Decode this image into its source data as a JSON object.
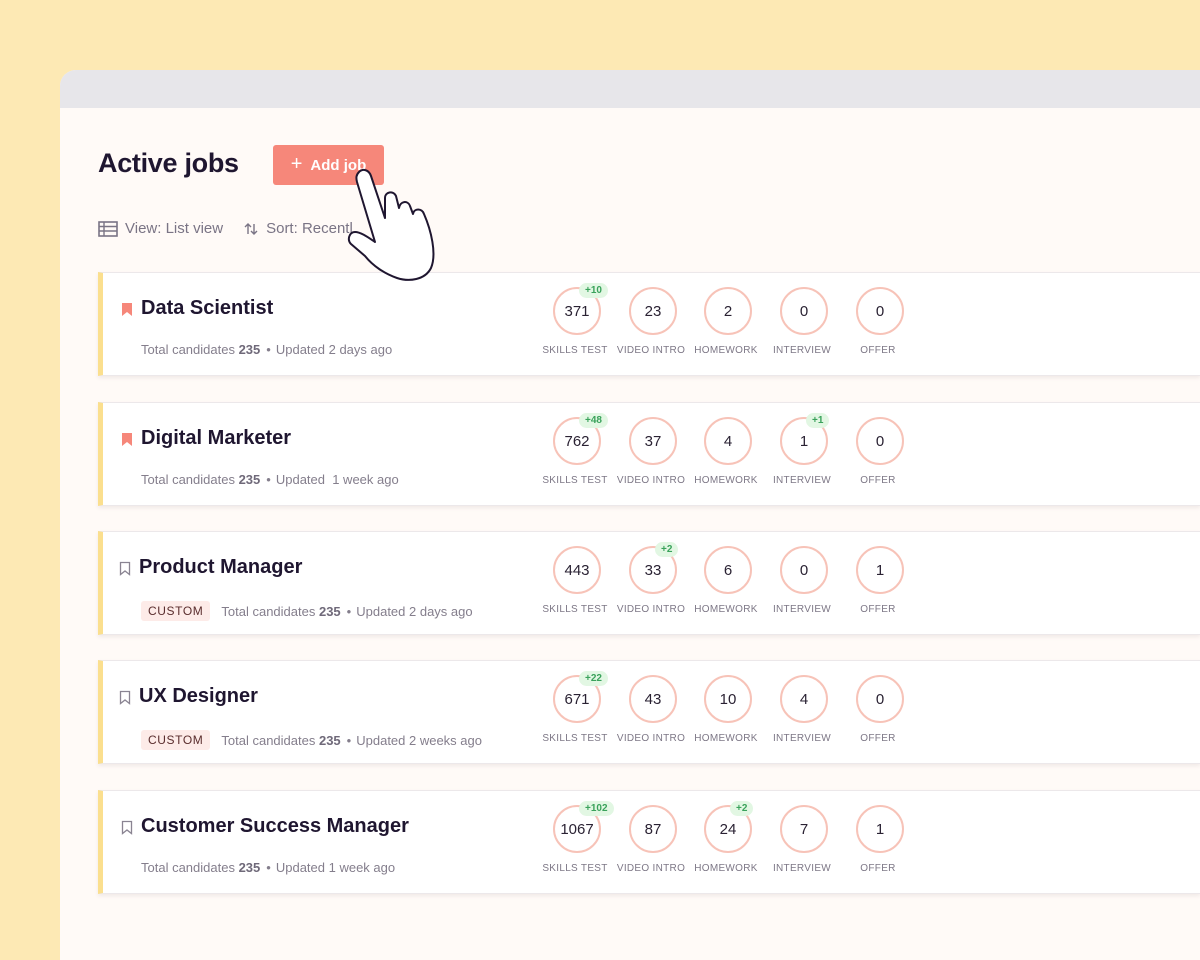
{
  "header": {
    "title": "Active jobs",
    "add_job_label": "Add job",
    "add_job_icon": "plus-icon"
  },
  "toolbar": {
    "view_label": "View: List view",
    "view_icon": "list-view-icon",
    "sort_label": "Sort: Recentl",
    "sort_icon": "sort-icon"
  },
  "colors": {
    "accent": "#f6877a",
    "background": "#fde9b4",
    "card_border": "#fbdf8e",
    "circle_border": "#f7c3b8",
    "delta_bg": "#e2f7e3",
    "delta_text": "#3aa25b"
  },
  "jobs": [
    {
      "title": "Data Scientist",
      "bookmarked": true,
      "custom": false,
      "total_label": "Total candidates",
      "total": "235",
      "updated": "Updated 2 days ago",
      "stages": [
        {
          "label": "SKILLS TEST",
          "count": "371",
          "delta": "+10"
        },
        {
          "label": "VIDEO INTRO",
          "count": "23",
          "delta": ""
        },
        {
          "label": "HOMEWORK",
          "count": "2",
          "delta": ""
        },
        {
          "label": "INTERVIEW",
          "count": "0",
          "delta": ""
        },
        {
          "label": "OFFER",
          "count": "0",
          "delta": ""
        }
      ]
    },
    {
      "title": "Digital Marketer",
      "bookmarked": true,
      "custom": false,
      "total_label": "Total candidates",
      "total": "235",
      "updated": "Updated  1 week ago",
      "stages": [
        {
          "label": "SKILLS TEST",
          "count": "762",
          "delta": "+48"
        },
        {
          "label": "VIDEO INTRO",
          "count": "37",
          "delta": ""
        },
        {
          "label": "HOMEWORK",
          "count": "4",
          "delta": ""
        },
        {
          "label": "INTERVIEW",
          "count": "1",
          "delta": "+1"
        },
        {
          "label": "OFFER",
          "count": "0",
          "delta": ""
        }
      ]
    },
    {
      "title": "Product Manager",
      "bookmarked": false,
      "custom": true,
      "custom_label": "CUSTOM",
      "total_label": "Total candidates",
      "total": "235",
      "updated": "Updated 2 days ago",
      "stages": [
        {
          "label": "SKILLS TEST",
          "count": "443",
          "delta": ""
        },
        {
          "label": "VIDEO INTRO",
          "count": "33",
          "delta": "+2"
        },
        {
          "label": "HOMEWORK",
          "count": "6",
          "delta": ""
        },
        {
          "label": "INTERVIEW",
          "count": "0",
          "delta": ""
        },
        {
          "label": "OFFER",
          "count": "1",
          "delta": ""
        }
      ]
    },
    {
      "title": "UX Designer",
      "bookmarked": false,
      "custom": true,
      "custom_label": "CUSTOM",
      "total_label": "Total candidates",
      "total": "235",
      "updated": "Updated 2 weeks ago",
      "stages": [
        {
          "label": "SKILLS TEST",
          "count": "671",
          "delta": "+22"
        },
        {
          "label": "VIDEO INTRO",
          "count": "43",
          "delta": ""
        },
        {
          "label": "HOMEWORK",
          "count": "10",
          "delta": ""
        },
        {
          "label": "INTERVIEW",
          "count": "4",
          "delta": ""
        },
        {
          "label": "OFFER",
          "count": "0",
          "delta": ""
        }
      ]
    },
    {
      "title": "Customer Success Manager",
      "bookmarked": false,
      "custom": false,
      "total_label": "Total candidates",
      "total": "235",
      "updated": "Updated 1 week ago",
      "stages": [
        {
          "label": "SKILLS TEST",
          "count": "1067",
          "delta": "+102"
        },
        {
          "label": "VIDEO INTRO",
          "count": "87",
          "delta": ""
        },
        {
          "label": "HOMEWORK",
          "count": "24",
          "delta": "+2"
        },
        {
          "label": "INTERVIEW",
          "count": "7",
          "delta": ""
        },
        {
          "label": "OFFER",
          "count": "1",
          "delta": ""
        }
      ]
    }
  ]
}
